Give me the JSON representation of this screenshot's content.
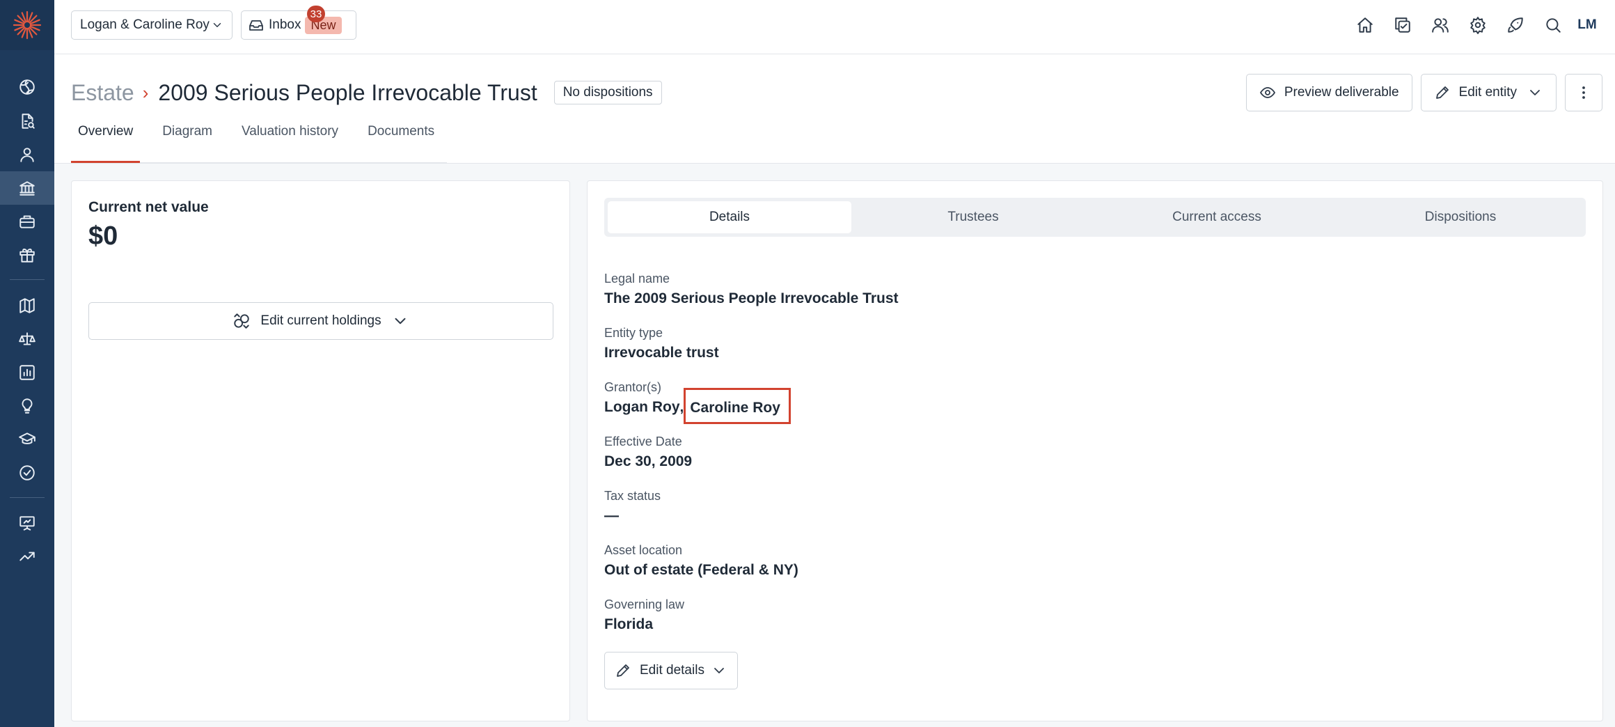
{
  "household": {
    "label": "Logan & Caroline Roy"
  },
  "inbox": {
    "label": "Inbox",
    "new_label": "New",
    "count": "33"
  },
  "user": {
    "initials": "LM"
  },
  "breadcrumb": {
    "root": "Estate",
    "title": "2009 Serious People Irrevocable Trust"
  },
  "status_badge": "No dispositions",
  "actions": {
    "preview": "Preview deliverable",
    "edit_entity": "Edit entity"
  },
  "tabs": [
    {
      "label": "Overview",
      "active": true
    },
    {
      "label": "Diagram"
    },
    {
      "label": "Valuation history"
    },
    {
      "label": "Documents"
    }
  ],
  "net_value": {
    "label": "Current net value",
    "value": "$0",
    "edit_holdings": "Edit current holdings"
  },
  "detail_tabs": [
    {
      "label": "Details",
      "active": true
    },
    {
      "label": "Trustees"
    },
    {
      "label": "Current access"
    },
    {
      "label": "Dispositions"
    }
  ],
  "details": {
    "legal_name": {
      "label": "Legal name",
      "value": "The 2009 Serious People Irrevocable Trust"
    },
    "entity_type": {
      "label": "Entity type",
      "value": "Irrevocable trust"
    },
    "grantors": {
      "label": "Grantor(s)",
      "first": "Logan Roy",
      "separator": ",",
      "second": "Caroline Roy"
    },
    "effective_date": {
      "label": "Effective Date",
      "value": "Dec 30, 2009"
    },
    "tax_status": {
      "label": "Tax status",
      "value": "—"
    },
    "asset_location": {
      "label": "Asset location",
      "value": "Out of estate (Federal & NY)"
    },
    "governing_law": {
      "label": "Governing law",
      "value": "Florida"
    },
    "edit_label": "Edit details"
  },
  "colors": {
    "rail": "#1e3a5c",
    "accent": "#d2432f",
    "badge_new": "#f4b8ae"
  },
  "rail_icons": [
    "globe-icon",
    "document-search-icon",
    "person-icon",
    "bank-icon",
    "briefcase-icon",
    "gift-icon",
    "map-icon",
    "scale-icon",
    "bar-chart-icon",
    "lightbulb-icon",
    "graduation-cap-icon",
    "check-circle-icon",
    "presentation-icon",
    "trending-up-icon"
  ]
}
